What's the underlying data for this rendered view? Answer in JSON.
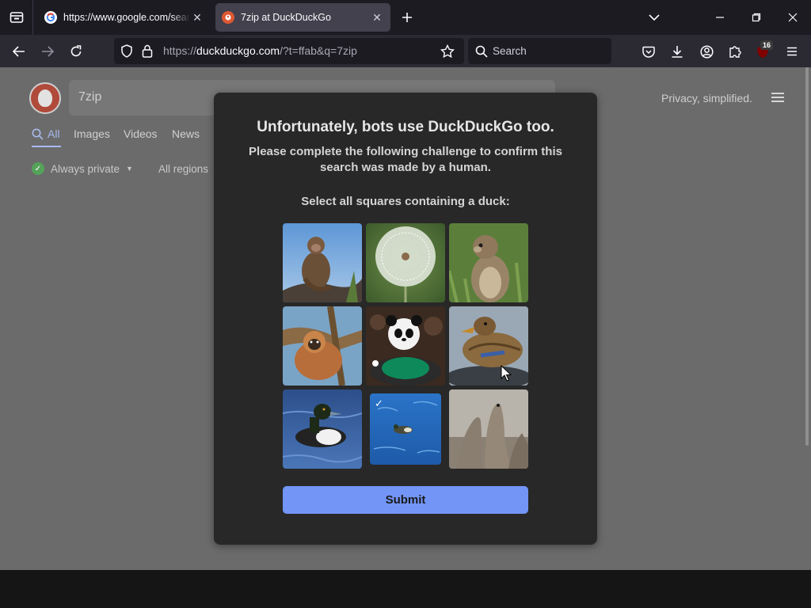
{
  "browser": {
    "tabs": [
      {
        "title": "https://www.google.com/search",
        "favicon": "google-g-icon",
        "active": false
      },
      {
        "title": "7zip at DuckDuckGo",
        "favicon": "duckduckgo-icon",
        "active": true
      }
    ],
    "address": {
      "prefix": "https://",
      "host": "duckduckgo.com",
      "rest": "/?t=ffab&q=7zip"
    },
    "search_placeholder": "Search",
    "extensions_badge": "16"
  },
  "ddg": {
    "query": "7zip",
    "tagline": "Privacy, simplified.",
    "tabs": [
      "All",
      "Images",
      "Videos",
      "News"
    ],
    "always_private": "Always private",
    "regions": "All regions"
  },
  "challenge": {
    "title": "Unfortunately, bots use DuckDuckGo too.",
    "description": "Please complete the following challenge to confirm this search was made by a human.",
    "instruction": "Select all squares containing a duck:",
    "tiles": [
      {
        "subject": "monkey",
        "selected": false
      },
      {
        "subject": "dandelion",
        "selected": false
      },
      {
        "subject": "squirrel",
        "selected": false
      },
      {
        "subject": "gibbon",
        "selected": false
      },
      {
        "subject": "panda",
        "selected": false
      },
      {
        "subject": "duck",
        "selected": false
      },
      {
        "subject": "duck",
        "selected": false
      },
      {
        "subject": "duck",
        "selected": true
      },
      {
        "subject": "seals",
        "selected": false
      }
    ],
    "submit_label": "Submit"
  },
  "colors": {
    "accent": "#7295f6",
    "modal_bg": "#282828",
    "tab_active": "#42414d"
  }
}
